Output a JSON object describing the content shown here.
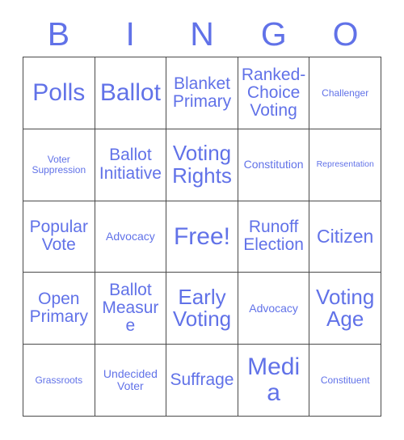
{
  "card": {
    "title": "BINGO",
    "text_color": "#6172e8",
    "grid_line_color": "#4a4a4a",
    "background_color": "#ffffff",
    "columns": 5,
    "rows": 5
  },
  "header": {
    "letters": [
      "B",
      "I",
      "N",
      "G",
      "O"
    ]
  },
  "grid": {
    "cells": [
      {
        "text": "Polls",
        "size": "fs-xxl"
      },
      {
        "text": "Ballot",
        "size": "fs-xxl"
      },
      {
        "text": "Blanket Primary",
        "size": "fs-md"
      },
      {
        "text": "Ranked-Choice Voting",
        "size": "fs-md"
      },
      {
        "text": "Challenger",
        "size": "fs-xs"
      },
      {
        "text": "Voter Suppression",
        "size": "fs-xs"
      },
      {
        "text": "Ballot Initiative",
        "size": "fs-md"
      },
      {
        "text": "Voting Rights",
        "size": "fs-xl"
      },
      {
        "text": "Constitution",
        "size": "fs-sm"
      },
      {
        "text": "Representation",
        "size": "fs-xxs"
      },
      {
        "text": "Popular Vote",
        "size": "fs-md"
      },
      {
        "text": "Advocacy",
        "size": "fs-sm"
      },
      {
        "text": "Free!",
        "size": "fs-xxl"
      },
      {
        "text": "Runoff Election",
        "size": "fs-md"
      },
      {
        "text": "Citizen",
        "size": "fs-lg"
      },
      {
        "text": "Open Primary",
        "size": "fs-md"
      },
      {
        "text": "Ballot Measure",
        "size": "fs-md"
      },
      {
        "text": "Early Voting",
        "size": "fs-xl"
      },
      {
        "text": "Advocacy",
        "size": "fs-sm"
      },
      {
        "text": "Voting Age",
        "size": "fs-xl"
      },
      {
        "text": "Grassroots",
        "size": "fs-xs"
      },
      {
        "text": "Undecided Voter",
        "size": "fs-sm"
      },
      {
        "text": "Suffrage",
        "size": "fs-md"
      },
      {
        "text": "Media",
        "size": "fs-xxl"
      },
      {
        "text": "Constituent",
        "size": "fs-xs"
      }
    ]
  }
}
